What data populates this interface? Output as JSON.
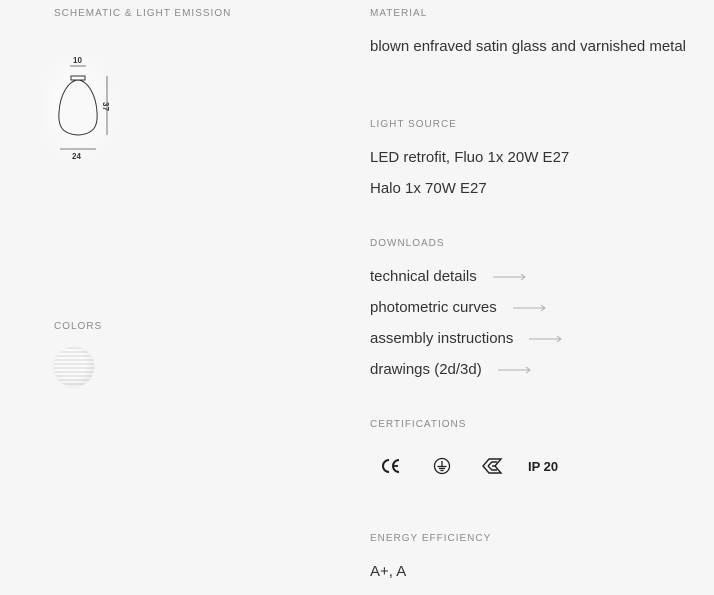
{
  "schematic": {
    "label": "SCHEMATIC & LIGHT EMISSION",
    "dim_top": "10",
    "dim_side": "37",
    "dim_bottom": "24"
  },
  "colors": {
    "label": "COLORS",
    "swatch_icon": "satin-glass-swatch"
  },
  "material": {
    "label": "MATERIAL",
    "value": "blown enfraved satin glass and varnished metal"
  },
  "light_source": {
    "label": "LIGHT SOURCE",
    "lines": [
      "LED retrofit, Fluo 1x 20W E27",
      "Halo 1x 70W E27"
    ]
  },
  "downloads": {
    "label": "DOWNLOADS",
    "items": [
      {
        "label": "technical details",
        "icon": "arrow-right-icon"
      },
      {
        "label": "photometric curves",
        "icon": "arrow-right-icon"
      },
      {
        "label": "assembly instructions",
        "icon": "arrow-right-icon"
      },
      {
        "label": "drawings (2d/3d)",
        "icon": "arrow-right-icon"
      }
    ]
  },
  "certifications": {
    "label": "CERTIFICATIONS",
    "items": [
      {
        "icon": "ce-mark-icon"
      },
      {
        "icon": "ground-symbol-icon"
      },
      {
        "icon": "enec-mark-icon"
      },
      {
        "text": "IP 20"
      }
    ]
  },
  "energy": {
    "label": "ENERGY EFFICIENCY",
    "value": "A+, A"
  },
  "colors_theme": {
    "text": "#333333",
    "label": "#8a8a8a",
    "background": "#f6f6f6"
  }
}
